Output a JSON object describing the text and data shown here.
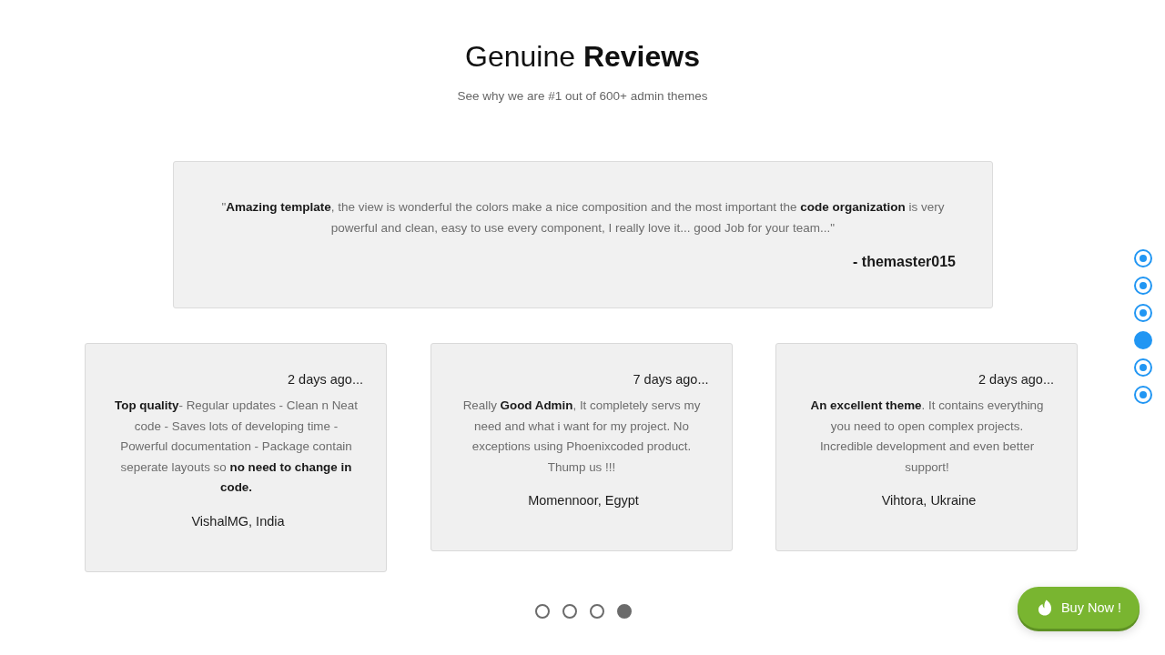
{
  "header": {
    "title": "Genuine **Reviews**",
    "subtitle": "See why we are #1 out of 600+ admin themes"
  },
  "featured_review": {
    "quote": "\"**Amazing template**, the view is wonderful the colors make a nice composition and the most important the **code organization** is very powerful and clean, easy to use every component, I really love it... good Job for your team...\"",
    "author": "- themaster015"
  },
  "reviews": [
    {
      "time": "2 days ago...",
      "text": "**Top quality**- Regular updates - Clean n Neat code - Saves lots of developing time - Powerful documentation - Package contain seperate layouts so **no need to change in code.**",
      "author": "VishalMG, India"
    },
    {
      "time": "7 days ago...",
      "text": "Really **Good Admin**, It completely servs my need and what i want for my project. No exceptions using Phoenixcoded product. Thump us !!!",
      "author": "Momennoor, Egypt"
    },
    {
      "time": "2 days ago...",
      "text": "**An excellent theme**. It contains everything you need to open complex projects. Incredible development and even better support!",
      "author": "Vihtora, Ukraine"
    }
  ],
  "carousel_dots": [
    {
      "selected": false
    },
    {
      "selected": false
    },
    {
      "selected": false
    },
    {
      "selected": true
    }
  ],
  "side_nav": [
    {
      "selected": false
    },
    {
      "selected": false
    },
    {
      "selected": false
    },
    {
      "selected": true
    },
    {
      "selected": false
    },
    {
      "selected": false
    }
  ],
  "buy_button": {
    "label": "Buy Now !"
  }
}
